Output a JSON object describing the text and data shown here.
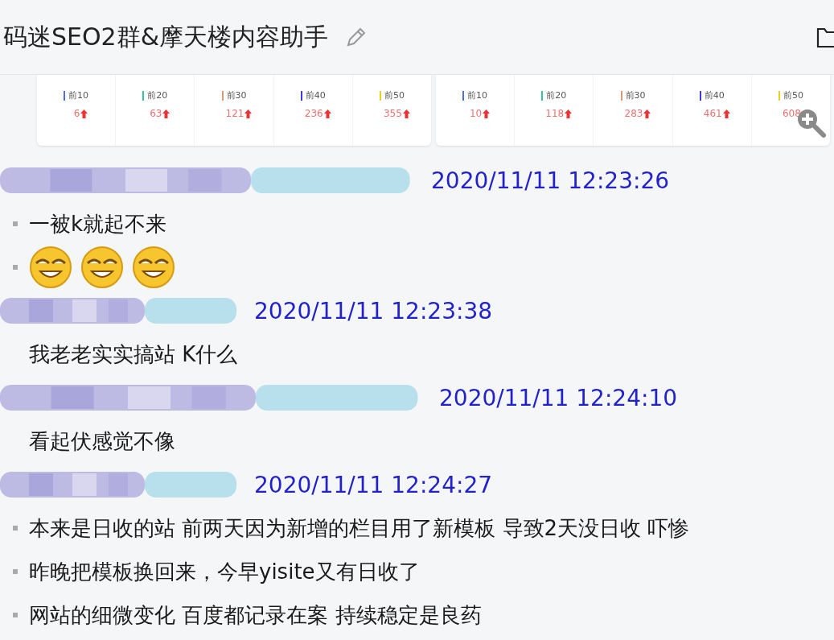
{
  "title": "码迷SEO2群&摩天楼内容助手",
  "stats_panels": [
    {
      "items": [
        {
          "label": "前10",
          "value": "6",
          "color": "#4a6cf0"
        },
        {
          "label": "前20",
          "value": "63",
          "color": "#2fc4a0"
        },
        {
          "label": "前30",
          "value": "121",
          "color": "#d99a6c"
        },
        {
          "label": "前40",
          "value": "236",
          "color": "#3a3ae0"
        },
        {
          "label": "前50",
          "value": "355",
          "color": "#e8d020"
        }
      ]
    },
    {
      "items": [
        {
          "label": "前10",
          "value": "10",
          "color": "#4a6cf0"
        },
        {
          "label": "前20",
          "value": "118",
          "color": "#2fc4a0"
        },
        {
          "label": "前30",
          "value": "283",
          "color": "#d99a6c"
        },
        {
          "label": "前40",
          "value": "461",
          "color": "#3a3ae0"
        },
        {
          "label": "前50",
          "value": "608",
          "color": "#e8d020"
        }
      ]
    }
  ],
  "messages": [
    {
      "time": "2020/11/11 12:23:26",
      "bulleted": true,
      "lines": [
        {
          "kind": "text",
          "text": "一被k就起不来"
        },
        {
          "kind": "emoji",
          "emojis": [
            {
              "kind": "grin"
            },
            {
              "kind": "grin"
            },
            {
              "kind": "grin"
            }
          ]
        }
      ]
    },
    {
      "time": "2020/11/11 12:23:38",
      "bulleted": false,
      "lines": [
        {
          "kind": "text",
          "text": "我老老实实搞站 K什么"
        }
      ]
    },
    {
      "time": "2020/11/11 12:24:10",
      "bulleted": false,
      "lines": [
        {
          "kind": "text",
          "text": "看起伏感觉不像"
        }
      ]
    },
    {
      "time": "2020/11/11 12:24:27",
      "bulleted": true,
      "lines": [
        {
          "kind": "text",
          "text": "本来是日收的站  前两天因为新增的栏目用了新模板  导致2天没日收 吓惨"
        },
        {
          "kind": "text",
          "text": "昨晚把模板换回来，今早yisite又有日收了"
        },
        {
          "kind": "text",
          "text": "网站的细微变化  百度都记录在案  持续稳定是良药"
        }
      ]
    }
  ]
}
